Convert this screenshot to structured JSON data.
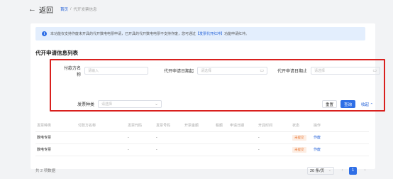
{
  "header": {
    "back_label": "返回",
    "breadcrumb": [
      "首页",
      "代开发票信息"
    ]
  },
  "notice": {
    "text_before": "本功能仅支持作废未开具的代开数电电票申请，已开具的代开数电电票不支持作废，您可通过",
    "highlight": "【发票代开红冲】",
    "text_after": "功能申请红冲。"
  },
  "section_title": "代开申请信息列表",
  "filters": {
    "payer_label": "付款方名称",
    "payer_placeholder": "请输入",
    "date_start_label": "代开申请日期起",
    "date_start_placeholder": "请选择",
    "date_end_label": "代开申请日期止",
    "date_end_placeholder": "请选择",
    "invoice_type_label": "发票种类",
    "invoice_type_placeholder": "请选择",
    "reset_label": "重置",
    "query_label": "查询",
    "collapse_label": "收起"
  },
  "table": {
    "columns": [
      "发票种类",
      "付款方名称",
      "发票代码",
      "发票号码",
      "开票金额",
      "税额",
      "申请日期",
      "开具时间",
      "状态",
      "操作"
    ],
    "rows": [
      {
        "type": "数电专票",
        "payer": "",
        "code": "-",
        "number": "-",
        "amount": "",
        "tax": "",
        "apply_date": "",
        "issue_time": "-",
        "status": "未提交",
        "action": "作废"
      },
      {
        "type": "数电专票",
        "payer": "",
        "code": "-",
        "number": "-",
        "amount": "",
        "tax": "",
        "apply_date": "",
        "issue_time": "-",
        "status": "未提交",
        "action": "作废"
      }
    ]
  },
  "pagination": {
    "total_text": "共 2 项数据",
    "page_size": "20 条/页",
    "current_page": "1"
  },
  "colors": {
    "accent": "#2f6fe6",
    "highlight_box": "#d9201e",
    "status_tag": "#e8742f"
  }
}
